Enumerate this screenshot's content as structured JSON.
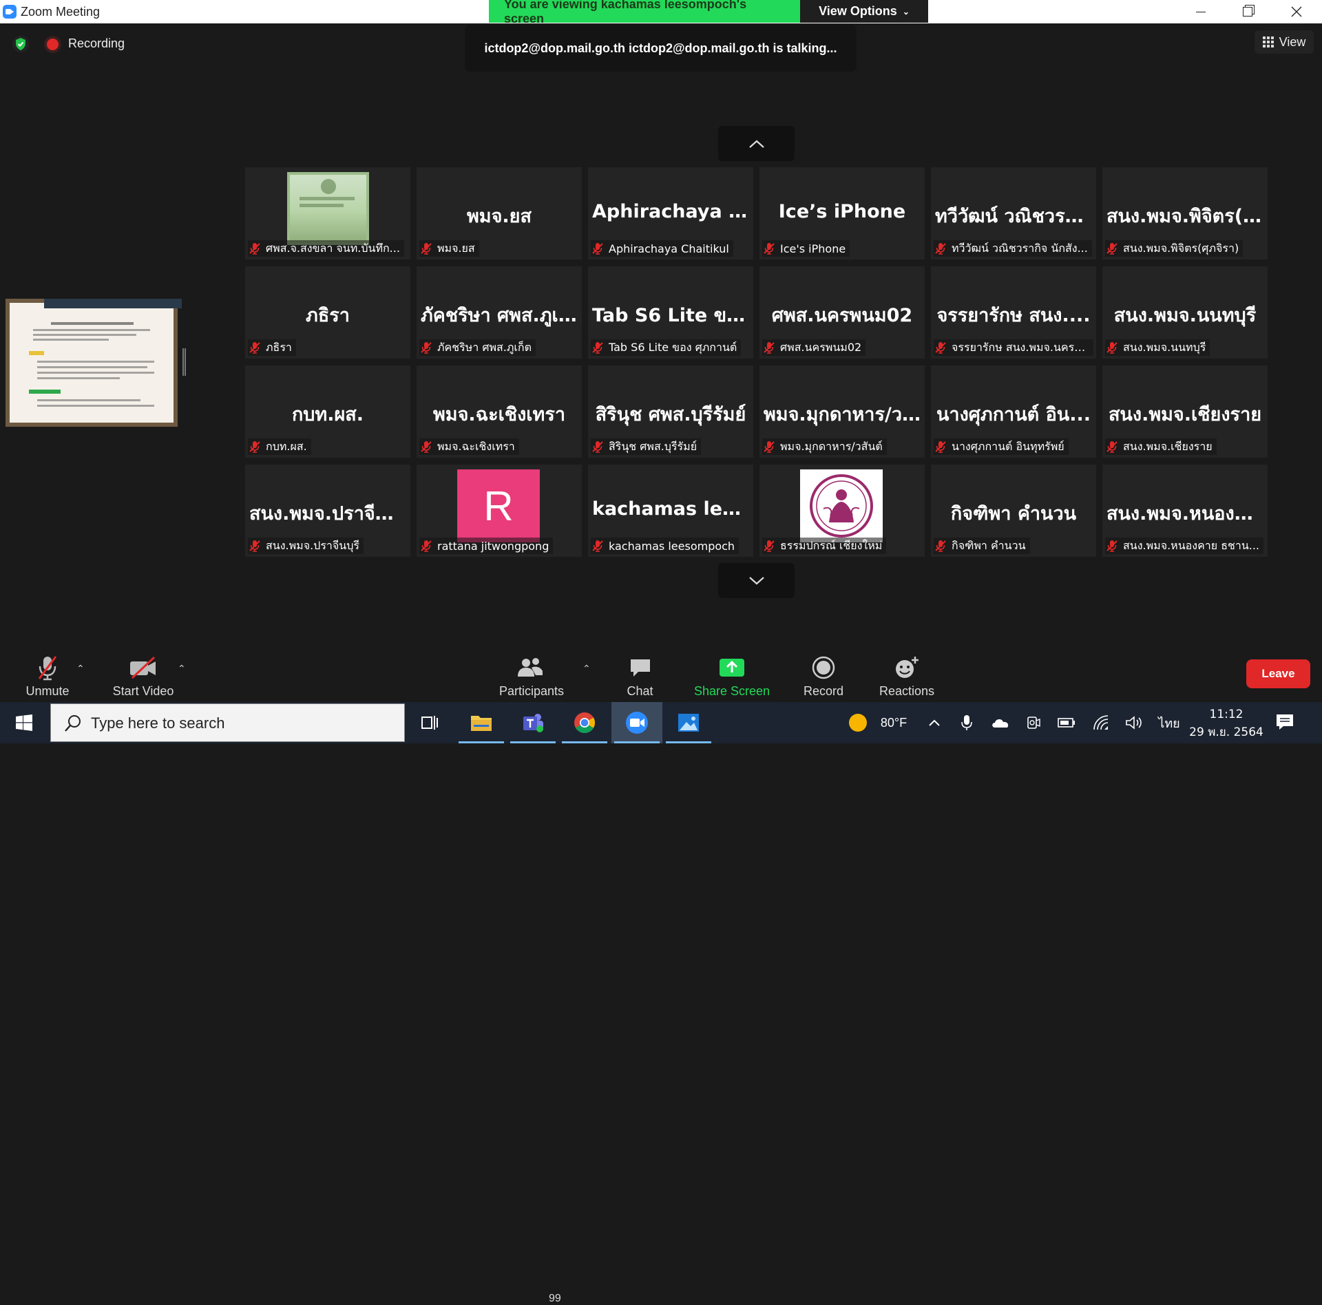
{
  "window": {
    "title": "Zoom Meeting",
    "controls": [
      "minimize",
      "maximize",
      "close"
    ]
  },
  "banner": {
    "viewing": "You are viewing kachamas leesompoch's screen",
    "options": "View Options"
  },
  "status": {
    "recording": "Recording",
    "talking": "ictdop2@dop.mail.go.th ictdop2@dop.mail.go.th is talking...",
    "view": "View"
  },
  "tiles": [
    {
      "big": "",
      "name": "ศพส.จ.สงขลา จนท.บันทึก...",
      "thumb": "doc"
    },
    {
      "big": "พมจ.ยส",
      "name": "พมจ.ยส"
    },
    {
      "big": "Aphirachaya Ch...",
      "name": "Aphirachaya Chaitikul"
    },
    {
      "big": "Ice’s iPhone",
      "name": "Ice's iPhone"
    },
    {
      "big": "ทวีวัฒน์ วณิชวรา...",
      "name": "ทวีวัฒน์ วณิชวรากิจ นักสัง..."
    },
    {
      "big": "สนง.พมจ.พิจิตร(...",
      "name": "สนง.พมจ.พิจิตร(ศุภจิรา)"
    },
    {
      "big": "ภธิรา",
      "name": "ภธิรา"
    },
    {
      "big": "ภัคชริษา ศพส.ภูเ...",
      "name": "ภัคชริษา ศพส.ภูเก็ต"
    },
    {
      "big": "Tab S6 Lite ของ...",
      "name": "Tab S6 Lite ของ ศุภกานต์"
    },
    {
      "big": "ศพส.นครพนม02",
      "name": "ศพส.นครพนม02"
    },
    {
      "big": "จรรยารักษ สนง....",
      "name": "จรรยารักษ สนง.พมจ.นครร..."
    },
    {
      "big": "สนง.พมจ.นนทบุรี",
      "name": "สนง.พมจ.นนทบุรี"
    },
    {
      "big": "กบท.ผส.",
      "name": "กบท.ผส."
    },
    {
      "big": "พมจ.ฉะเชิงเทรา",
      "name": "พมจ.ฉะเชิงเทรา"
    },
    {
      "big": "สิรินุช ศพส.บุรีรัมย์",
      "name": "สิรินุช ศพส.บุรีรัมย์"
    },
    {
      "big": "พมจ.มุกดาหาร/ว...",
      "name": "พมจ.มุกดาหาร/วสันต์"
    },
    {
      "big": "นางศุภกานต์ อิน...",
      "name": "นางศุภกานต์ อินทุทรัพย์"
    },
    {
      "big": "สนง.พมจ.เชียงราย",
      "name": "สนง.พมจ.เชียงราย"
    },
    {
      "big": "สนง.พมจ.ปราจีน...",
      "name": "สนง.พมจ.ปราจีนบุรี"
    },
    {
      "big": "",
      "name": "rattana jitwongpong",
      "avatar": "R",
      "avatar_color": "#ea3b7a"
    },
    {
      "big": "kachamas leeso...",
      "name": "kachamas leesompoch"
    },
    {
      "big": "",
      "name": "ธรรมปกรณ์ เชียงใหม่",
      "thumb": "seal"
    },
    {
      "big": "กิจฑิพา คำนวน",
      "name": "กิจฑิพา คำนวน"
    },
    {
      "big": "สนง.พมจ.หนองค...",
      "name": "สนง.พมจ.หนองคาย ธชาน..."
    }
  ],
  "toolbar": {
    "unmute": "Unmute",
    "start_video": "Start Video",
    "participants": "Participants",
    "participants_count": "99",
    "chat": "Chat",
    "share_screen": "Share Screen",
    "record": "Record",
    "reactions": "Reactions",
    "leave": "Leave"
  },
  "taskbar": {
    "search_placeholder": "Type here to search",
    "weather": "80°F",
    "language": "ไทย",
    "time": "11:12",
    "date": "29 พ.ย. 2564"
  },
  "colors": {
    "accent_green": "#23d959",
    "leave_red": "#e02828",
    "muted_red": "#e02828",
    "tile_bg": "#242424"
  }
}
